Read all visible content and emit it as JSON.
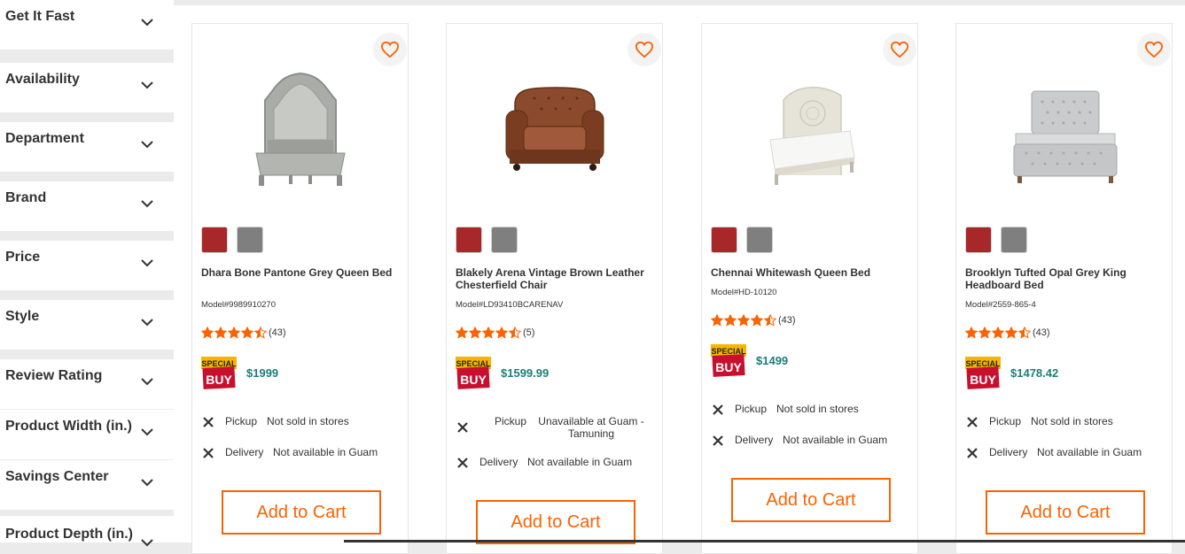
{
  "filters": [
    "Get It Fast",
    "Availability",
    "Department",
    "Brand",
    "Price",
    "Style",
    "Review Rating",
    "Product Width (in.)",
    "Savings Center",
    "Product Depth (in.)"
  ],
  "colors": {
    "accent": "#f96302",
    "price": "#1b7e79",
    "star": "#f96302",
    "swatch_red": "#a82728",
    "swatch_grey": "#7f7f7f"
  },
  "products": [
    {
      "title": "Dhara Bone Pantone Grey Queen Bed",
      "model": "Model#9989910270",
      "rating": 4.5,
      "review_count": "(43)",
      "badge_line1": "SPECIAL",
      "badge_line2": "BUY",
      "price": "$1999",
      "pickup_label": "Pickup",
      "pickup_status": "Not sold in stores",
      "delivery_label": "Delivery",
      "delivery_status": "Not available in Guam",
      "cart_label": "Add to Cart",
      "image_icon": "bed-grey-icon"
    },
    {
      "title": "Blakely Arena Vintage Brown Leather Chesterfield Chair",
      "model": "Model#LD93410BCARENAV",
      "rating": 4.5,
      "review_count": "(5)",
      "badge_line1": "SPECIAL",
      "badge_line2": "BUY",
      "price": "$1599.99",
      "pickup_label": "Pickup",
      "pickup_status": "Unavailable at Guam - Tamuning",
      "delivery_label": "Delivery",
      "delivery_status": "Not available in Guam",
      "cart_label": "Add to Cart",
      "image_icon": "leather-chair-icon"
    },
    {
      "title": "Chennai Whitewash Queen Bed",
      "model": "Model#HD-10120",
      "rating": 4.5,
      "review_count": "(43)",
      "badge_line1": "SPECIAL",
      "badge_line2": "BUY",
      "price": "$1499",
      "pickup_label": "Pickup",
      "pickup_status": "Not sold in stores",
      "delivery_label": "Delivery",
      "delivery_status": "Not available in Guam",
      "cart_label": "Add to Cart",
      "image_icon": "bed-white-icon"
    },
    {
      "title": "Brooklyn Tufted Opal Grey King Headboard Bed",
      "model": "Model#2559-865-4",
      "rating": 4.5,
      "review_count": "(43)",
      "badge_line1": "SPECIAL",
      "badge_line2": "BUY",
      "price": "$1478.42",
      "pickup_label": "Pickup",
      "pickup_status": "Not sold in stores",
      "delivery_label": "Delivery",
      "delivery_status": "Not available in Guam",
      "cart_label": "Add to Cart",
      "image_icon": "tufted-bed-icon"
    }
  ]
}
